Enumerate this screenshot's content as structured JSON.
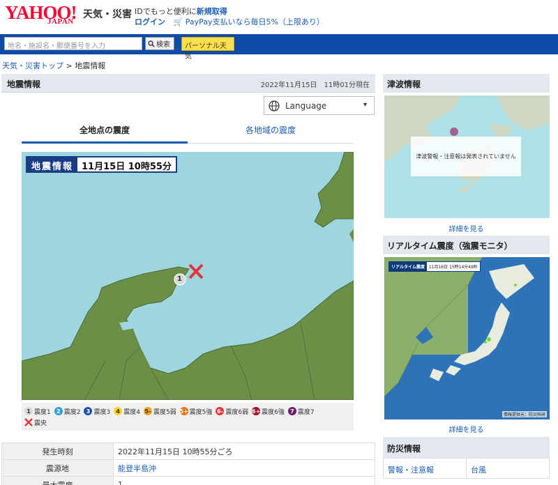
{
  "header": {
    "logo": "YAHOO!",
    "logo_sub": "JAPAN",
    "service": "天気・災害",
    "promo_text": "IDでもっと便利に",
    "signup": "新規取得",
    "login": "ログイン",
    "paypay": "PayPay支払いなら毎日5%（上限あり）"
  },
  "search": {
    "placeholder": "地名・施設名・郵便番号を入力",
    "button": "検索",
    "personal": "パーソナル天気"
  },
  "breadcrumb": {
    "top": "天気・災害トップ",
    "sep": " > ",
    "current": "地震情報"
  },
  "main": {
    "title": "地震情報",
    "timestamp": "2022年11月15日　11時01分現在",
    "language": "Language",
    "tabs": [
      {
        "label": "全地点の震度"
      },
      {
        "label": "各地域の震度"
      }
    ],
    "map_label_title": "地震情報",
    "map_label_time": "11月15日 10時55分",
    "intensity_marker": "1"
  },
  "legend": {
    "items": [
      {
        "badge": "1",
        "label": "震度1",
        "color": "#d9d9d9",
        "text_color": "#333"
      },
      {
        "badge": "2",
        "label": "震度2",
        "color": "#2f9ddb",
        "text_color": "#fff"
      },
      {
        "badge": "3",
        "label": "震度3",
        "color": "#1b50a8",
        "text_color": "#fff"
      },
      {
        "badge": "4",
        "label": "震度4",
        "color": "#f5d329",
        "text_color": "#333"
      },
      {
        "badge": "5-",
        "label": "震度5弱",
        "color": "#f5a623",
        "text_color": "#333"
      },
      {
        "badge": "5+",
        "label": "震度5強",
        "color": "#e8741c",
        "text_color": "#fff"
      },
      {
        "badge": "6-",
        "label": "震度6弱",
        "color": "#e5333a",
        "text_color": "#fff"
      },
      {
        "badge": "6+",
        "label": "震度6強",
        "color": "#a5102a",
        "text_color": "#fff"
      },
      {
        "badge": "7",
        "label": "震度7",
        "color": "#6e1f6b",
        "text_color": "#fff"
      }
    ],
    "epicenter": "震央"
  },
  "info_table": [
    {
      "key": "発生時刻",
      "value": "2022年11月15日 10時55分ごろ",
      "link": false
    },
    {
      "key": "震源地",
      "value": "能登半島沖",
      "link": true
    },
    {
      "key": "最大震度",
      "value": "1",
      "link": false
    }
  ],
  "sidebar": {
    "tsunami_title": "津波情報",
    "tsunami_notice": "津波警報・注意報は発表されていません",
    "detail": "詳細を見る",
    "realtime_title": "リアルタイム震度（強震モニタ）",
    "realtime_label": "リアルタイム震度",
    "realtime_time": "11月16日 15時14分49秒",
    "credit": "情報提供元：防災科研",
    "bousai_title": "防災情報",
    "bousai_links": [
      "警報・注意報",
      "台風"
    ]
  },
  "colors": {
    "brand": "#ff0033",
    "nav": "#0f4aa8",
    "link": "#1a5cb4",
    "land": "#6c8e47",
    "sea": "#9ed6e0",
    "epicenter": "#e5333a"
  }
}
